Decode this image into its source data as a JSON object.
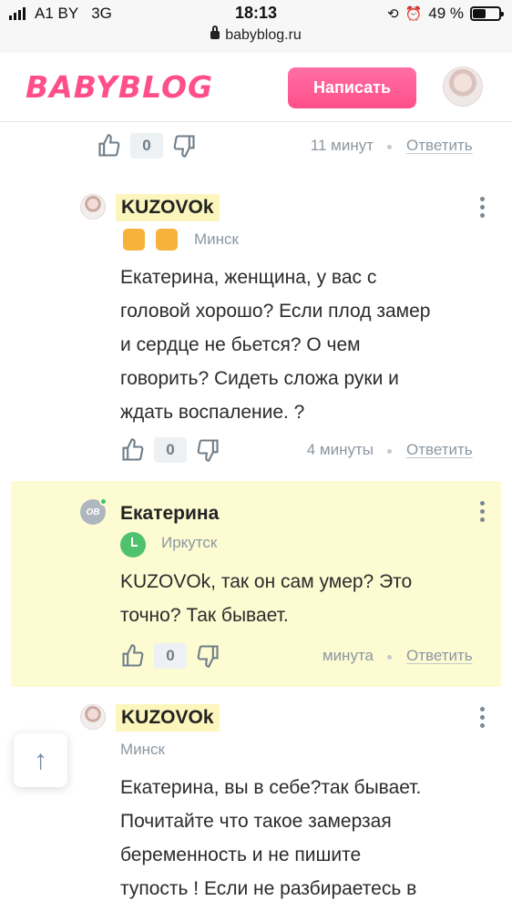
{
  "statusbar": {
    "carrier": "A1 BY",
    "network": "3G",
    "time": "18:13",
    "battery": "49 %",
    "battery_level": 0.49,
    "url": "babyblog.ru"
  },
  "header": {
    "logo": "BABYBLOG",
    "write_button": "Написать"
  },
  "comments": [
    {
      "likes": "0",
      "time": "11 минут",
      "reply": "Ответить"
    },
    {
      "author": "KUZOVOk",
      "city": "Минск",
      "text_lines": [
        "Екатерина, женщина, у вас с",
        "головой хорошо? Если плод замер",
        "и сердце не бьется? О чем",
        "говорить? Сидеть сложа руки и",
        "ждать воспаление. ?"
      ],
      "likes": "0",
      "time": "4 минуты",
      "reply": "Ответить"
    },
    {
      "author": "Екатерина",
      "avatar_text": "ОВ",
      "city": "Иркутск",
      "text_lines": [
        "KUZOVOk, так он сам умер? Это",
        "точно? Так бывает."
      ],
      "likes": "0",
      "time": "минута",
      "reply": "Ответить"
    },
    {
      "author": "KUZOVOk",
      "city": "Минск",
      "text_lines": [
        "Екатерина, вы в себе?так бывает.",
        "Почитайте что такое замерзая",
        "беременность и не пишите",
        "тупость ! Если не разбираетесь в"
      ]
    }
  ],
  "scroll_top": "↑",
  "colors": {
    "brand": "#ff4f8b",
    "name_highlight": "#fcf6bd",
    "reply_highlight_bg": "#fdfbd2",
    "muted": "#8b97a1"
  }
}
